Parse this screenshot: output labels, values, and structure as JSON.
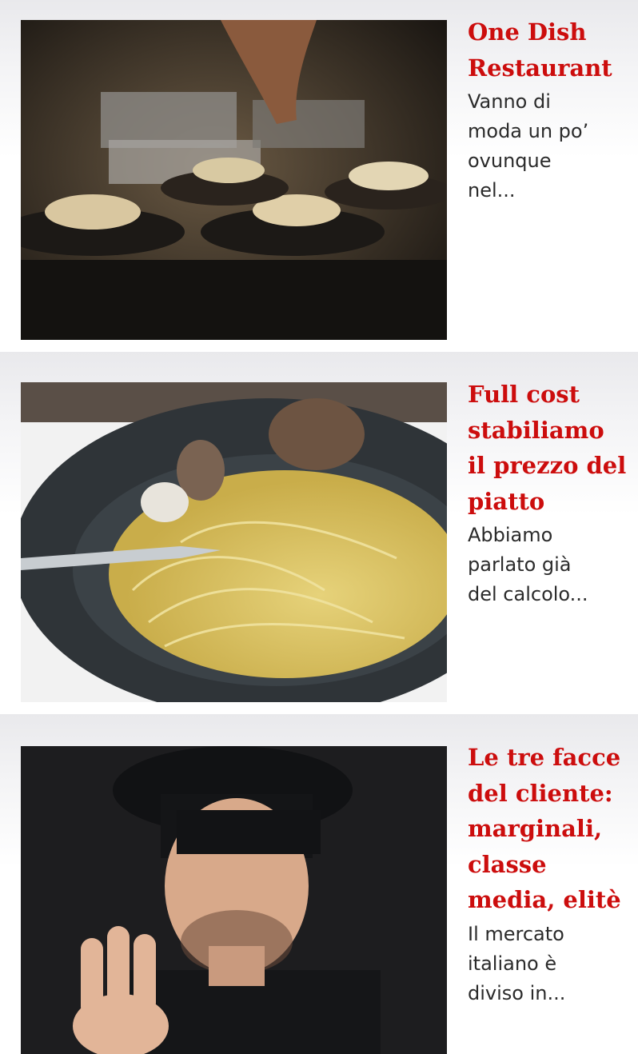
{
  "articles": [
    {
      "title": "One Dish\nRestaurant",
      "excerpt": "Vanno di\nmoda un po’\novunque\nnel...",
      "image": "restaurant-kitchen-bowls-photo"
    },
    {
      "title": "Full cost\nstabiliamo\nil prezzo del\npiatto",
      "excerpt": "Abbiamo\nparlato già\ndel calcolo...",
      "image": "spaghetti-clams-photo"
    },
    {
      "title": "Le tre facce\ndel cliente:\nmarginali,\nclasse\nmedia, elitè",
      "excerpt": "Il mercato\nitaliano è\ndiviso in...",
      "image": "chef-three-fingers-photo"
    }
  ],
  "colors": {
    "title_red": "#cc0d0d",
    "excerpt_text": "#2b2b2b",
    "card_gradient_top": "#e9e9ec"
  }
}
